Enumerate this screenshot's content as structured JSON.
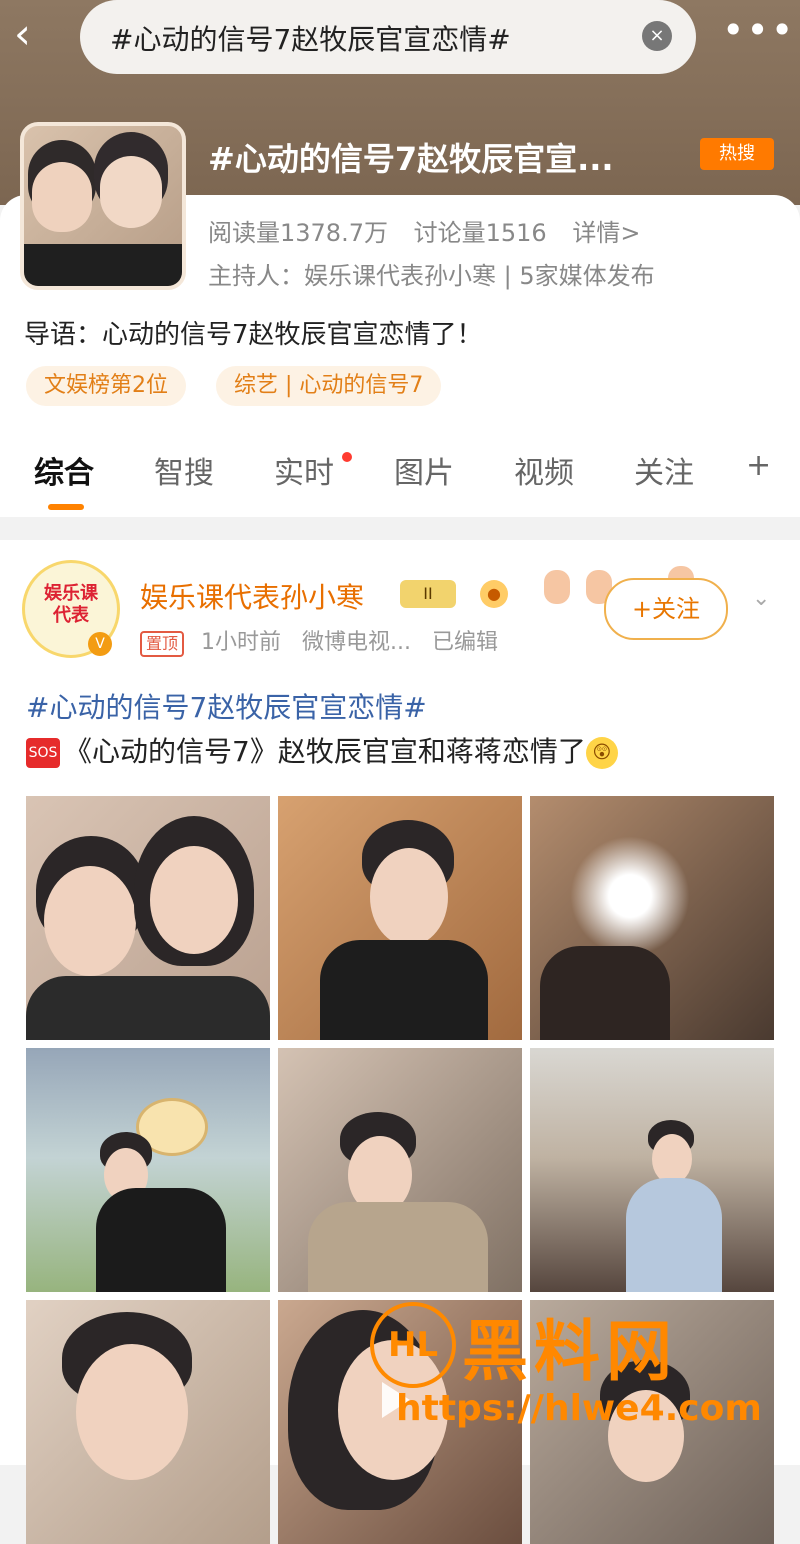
{
  "topbar": {
    "search_query": "#心动的信号7赵牧辰官宣恋情#",
    "back_icon": "chevron-left-icon",
    "clear_icon": "close-icon",
    "more_icon": "more-horizontal-icon"
  },
  "topic": {
    "title": "#心动的信号7赵牧辰官宣...",
    "hot_badge": "热搜",
    "reads": "阅读量1378.7万",
    "discussions": "讨论量1516",
    "details_link": "详情>",
    "host_line": "主持人：娱乐课代表孙小寒 | 5家媒体发布",
    "intro": "导语：心动的信号7赵牧辰官宣恋情了！",
    "tags": [
      "文娱榜第2位",
      "综艺 | 心动的信号7"
    ]
  },
  "tabs": [
    {
      "label": "综合",
      "active": true
    },
    {
      "label": "智搜"
    },
    {
      "label": "实时",
      "dot": true
    },
    {
      "label": "图片"
    },
    {
      "label": "视频"
    },
    {
      "label": "关注"
    },
    {
      "label": "+"
    }
  ],
  "post": {
    "author": "娱乐课代表孙小寒",
    "avatar_text": "娱乐课代表",
    "level_badge": "II",
    "pin_badge": "置顶",
    "time": "1小时前",
    "source": "微博电视...",
    "edited": "已编辑",
    "follow_label": "+关注",
    "hashtag": "#心动的信号7赵牧辰官宣恋情#",
    "body": "《心动的信号7》赵牧辰官宣和蒋蒋恋情了",
    "sos_label": "SOS",
    "emoji_label": "😲"
  },
  "watermark": {
    "logo_text": "HL",
    "title": "黑料网",
    "url": "https://hlwe4.com"
  },
  "colors": {
    "accent_orange": "#ff8200",
    "hashtag_blue": "#3a63a7",
    "hot_orange": "#ff7a00"
  }
}
